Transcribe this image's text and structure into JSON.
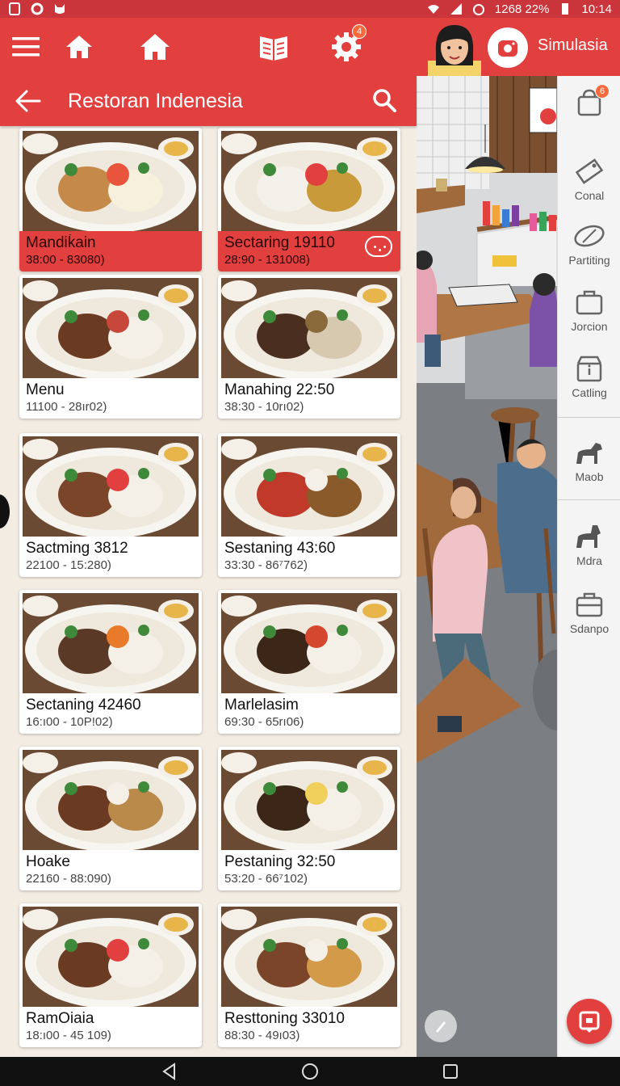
{
  "status_bar": {
    "right_text": "1268 22% ",
    "clock": "10:14",
    "icons": [
      "square-icon",
      "circle-icon",
      "cat-icon",
      "wifi-icon",
      "signal-icon",
      "data-icon",
      "alarm-icon",
      "battery-icon"
    ]
  },
  "toolbar": {
    "icons": [
      "menu-icon",
      "home-icon",
      "home-large-icon",
      "book-icon",
      "gear-icon"
    ],
    "settings_badge": "4",
    "brand_label": "Simulasia"
  },
  "panel": {
    "title": "Restoran Indenesia",
    "back_icon": "arrow-left-icon",
    "search_icon": "search-icon"
  },
  "menu_items": [
    {
      "name": "Mandiḱain",
      "time": "38:00      - 83080)",
      "highlight": true
    },
    {
      "name": "Sectaring 19110",
      "time": "28:90      - 131008)",
      "highlight": true
    },
    {
      "name": "Menu",
      "time": "11100      - 28ır02)",
      "highlight": false
    },
    {
      "name": "Manahing 22:50",
      "time": "38:30      - 10rı02)",
      "highlight": false
    },
    {
      "name": "Sactming 3812",
      "time": "22100      - 15:280)",
      "highlight": false
    },
    {
      "name": "Sestaning 43:60",
      "time": "33:30      - 86⁷762)",
      "highlight": false
    },
    {
      "name": "Sectaning 42460",
      "time": "16:ı00      - 10P!02)",
      "highlight": false
    },
    {
      "name": "Marlelasim",
      "time": "69:30      - 65rı06)",
      "highlight": false
    },
    {
      "name": "Hoake",
      "time": "22160      - 88:090)",
      "highlight": false
    },
    {
      "name": "Pestaning 32:50",
      "time": "53:20      - 66⁷102)",
      "highlight": false
    },
    {
      "name": "RamOiaia",
      "time": "18:ı00      - 45 109)",
      "highlight": false
    },
    {
      "name": "Resttoning 33010",
      "time": "88:30      - 49ı03)",
      "highlight": false
    }
  ],
  "rail": {
    "badge": "6",
    "items": [
      {
        "label": "",
        "icon": "bag-icon"
      },
      {
        "label": "Conal",
        "icon": "tag-icon"
      },
      {
        "label": "Partiting",
        "icon": "pill-icon"
      },
      {
        "label": "Jorcion",
        "icon": "briefcase-icon"
      },
      {
        "label": "Catling",
        "icon": "shop-icon"
      },
      {
        "label": "Maob",
        "icon": "dog-icon"
      },
      {
        "label": "Mdra",
        "icon": "dog-icon"
      },
      {
        "label": "Sdanpo",
        "icon": "case-icon"
      }
    ]
  },
  "colors": {
    "brand_red": "#e2403f",
    "status_red": "#c9353a",
    "list_background": "#f3ece3"
  }
}
